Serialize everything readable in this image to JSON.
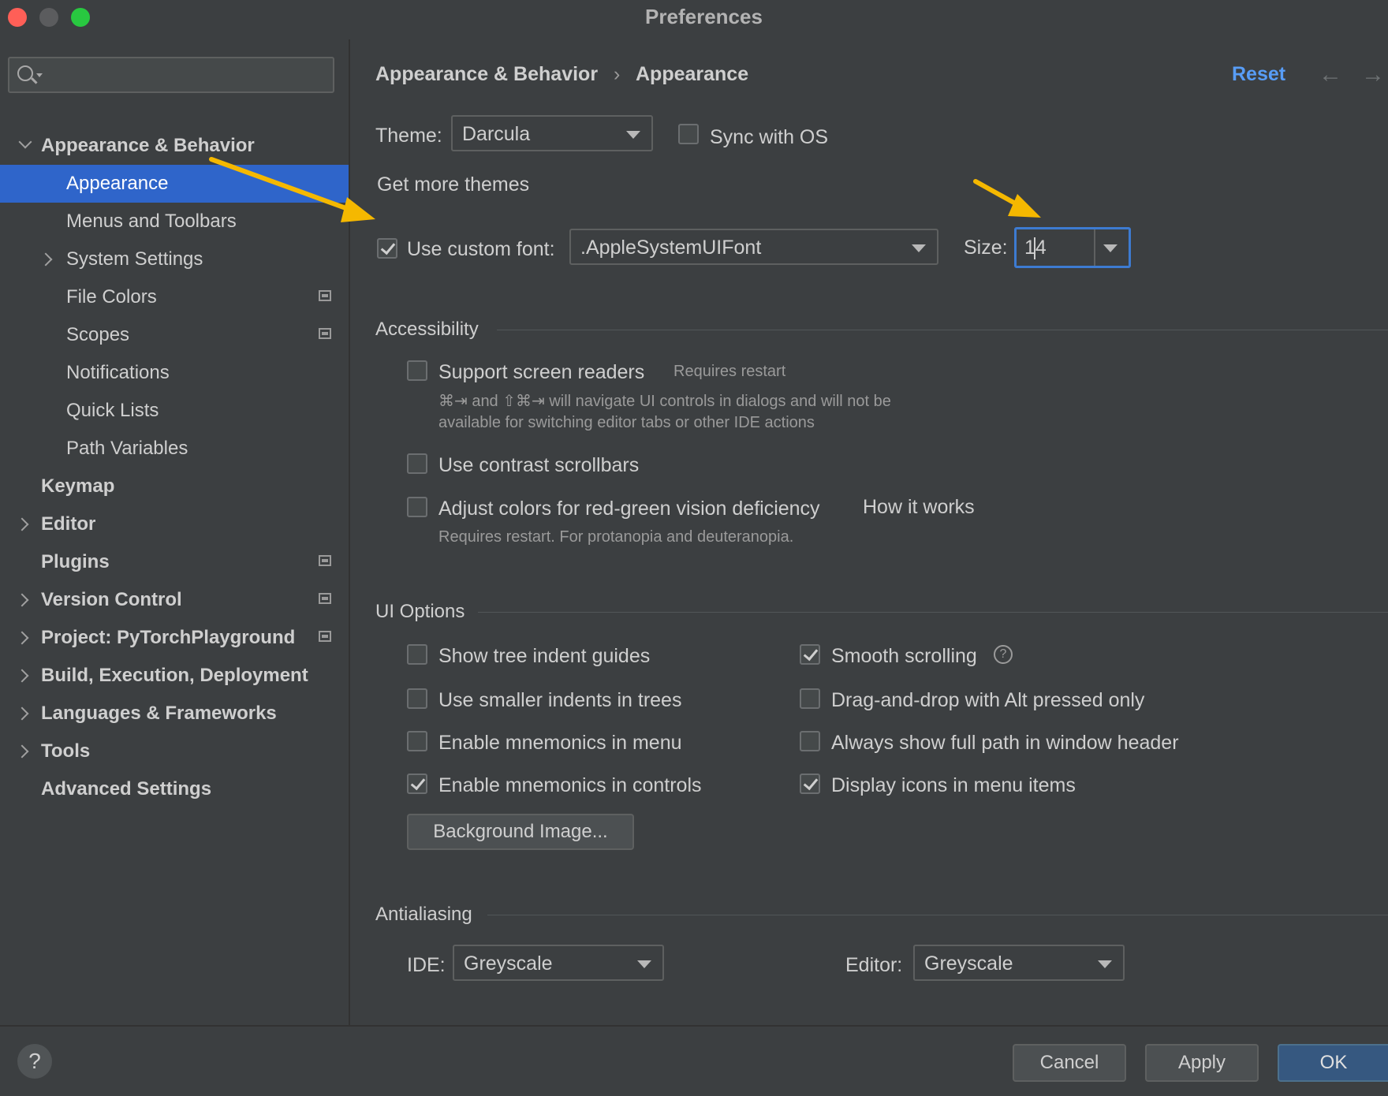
{
  "window": {
    "title": "Preferences"
  },
  "sidebar": {
    "search_placeholder": "",
    "items": [
      {
        "label": "Appearance & Behavior",
        "bold": true,
        "expanded": true
      },
      {
        "label": "Appearance",
        "selected": true
      },
      {
        "label": "Menus and Toolbars"
      },
      {
        "label": "System Settings"
      },
      {
        "label": "File Colors"
      },
      {
        "label": "Scopes"
      },
      {
        "label": "Notifications"
      },
      {
        "label": "Quick Lists"
      },
      {
        "label": "Path Variables"
      },
      {
        "label": "Keymap",
        "bold": true
      },
      {
        "label": "Editor",
        "bold": true
      },
      {
        "label": "Plugins",
        "bold": true
      },
      {
        "label": "Version Control",
        "bold": true
      },
      {
        "label": "Project: PyTorchPlayground",
        "bold": true
      },
      {
        "label": "Build, Execution, Deployment",
        "bold": true
      },
      {
        "label": "Languages & Frameworks",
        "bold": true
      },
      {
        "label": "Tools",
        "bold": true
      },
      {
        "label": "Advanced Settings",
        "bold": true
      }
    ]
  },
  "header": {
    "breadcrumb_parent": "Appearance & Behavior",
    "breadcrumb_sep": "›",
    "breadcrumb_current": "Appearance",
    "reset": "Reset",
    "back_arrow": "←",
    "forward_arrow": "→"
  },
  "theme": {
    "label": "Theme:",
    "value": "Darcula",
    "sync_label": "Sync with OS",
    "sync_checked": false,
    "more_themes": "Get more themes"
  },
  "font": {
    "custom_label": "Use custom font:",
    "custom_checked": true,
    "value": ".AppleSystemUIFont",
    "size_label": "Size:",
    "size_value": "14"
  },
  "accessibility": {
    "title": "Accessibility",
    "screen_readers": "Support screen readers",
    "screen_readers_hint": "Requires restart",
    "screen_readers_desc1": "⌘⇥ and ⇧⌘⇥ will navigate UI controls in dialogs and will not be",
    "screen_readers_desc2": "available for switching editor tabs or other IDE actions",
    "contrast": "Use contrast scrollbars",
    "colors": "Adjust colors for red-green vision deficiency",
    "how_it_works": "How it works",
    "colors_hint": "Requires restart. For protanopia and deuteranopia."
  },
  "ui_options": {
    "title": "UI Options",
    "left": [
      {
        "label": "Show tree indent guides",
        "checked": false
      },
      {
        "label": "Use smaller indents in trees",
        "checked": false
      },
      {
        "label": "Enable mnemonics in menu",
        "checked": false
      },
      {
        "label": "Enable mnemonics in controls",
        "checked": true
      }
    ],
    "right": [
      {
        "label": "Smooth scrolling",
        "checked": true
      },
      {
        "label": "Drag-and-drop with Alt pressed only",
        "checked": false
      },
      {
        "label": "Always show full path in window header",
        "checked": false
      },
      {
        "label": "Display icons in menu items",
        "checked": true
      }
    ],
    "help_glyph": "?",
    "background_image": "Background Image..."
  },
  "antialiasing": {
    "title": "Antialiasing",
    "ide_label": "IDE:",
    "ide_value": "Greyscale",
    "editor_label": "Editor:",
    "editor_value": "Greyscale"
  },
  "footer": {
    "help": "?",
    "cancel": "Cancel",
    "apply": "Apply",
    "ok": "OK"
  },
  "colors": {
    "background": "#3c3f41",
    "selection": "#2f65ca",
    "link": "#589df6",
    "annotation_arrow": "#f5b800",
    "focus": "#3d7bd1"
  }
}
